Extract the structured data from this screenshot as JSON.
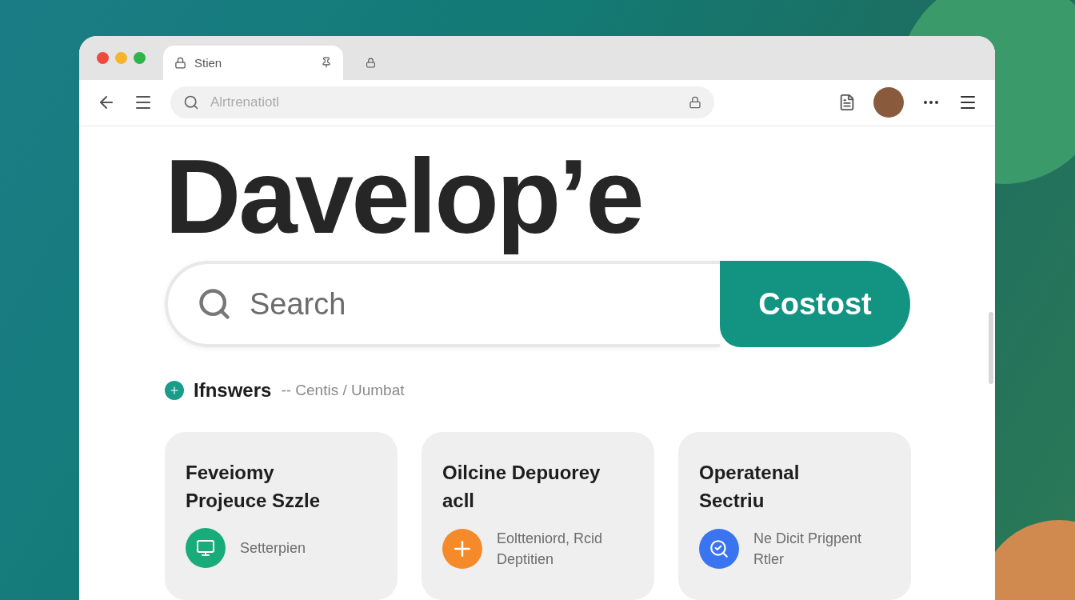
{
  "browser": {
    "tabs": [
      {
        "title": "Stien",
        "selected": true
      },
      {
        "selected": false
      }
    ],
    "address": {
      "placeholder": "Alrtrenatiotl"
    }
  },
  "logo": {
    "text": "Davelop’e"
  },
  "search": {
    "placeholder": "Search",
    "button": "Costost"
  },
  "section": {
    "title": "Ifnswers",
    "breadcrumb": "-- Centis / Uumbat"
  },
  "cards": [
    {
      "title": "Feveiomy Projeuce Szzle",
      "note": "Setterpien",
      "color": "#1aab7a",
      "kind": "screen"
    },
    {
      "title": "Oilcine Depuorey acll",
      "note": "Eoltteniord, Rcid Deptitien",
      "color": "#f58a2a",
      "kind": "plus"
    },
    {
      "title": "Operatenal Sectriu",
      "note": "Ne Dicit Prigpent Rtler",
      "color": "#3b74f0",
      "kind": "search"
    }
  ]
}
